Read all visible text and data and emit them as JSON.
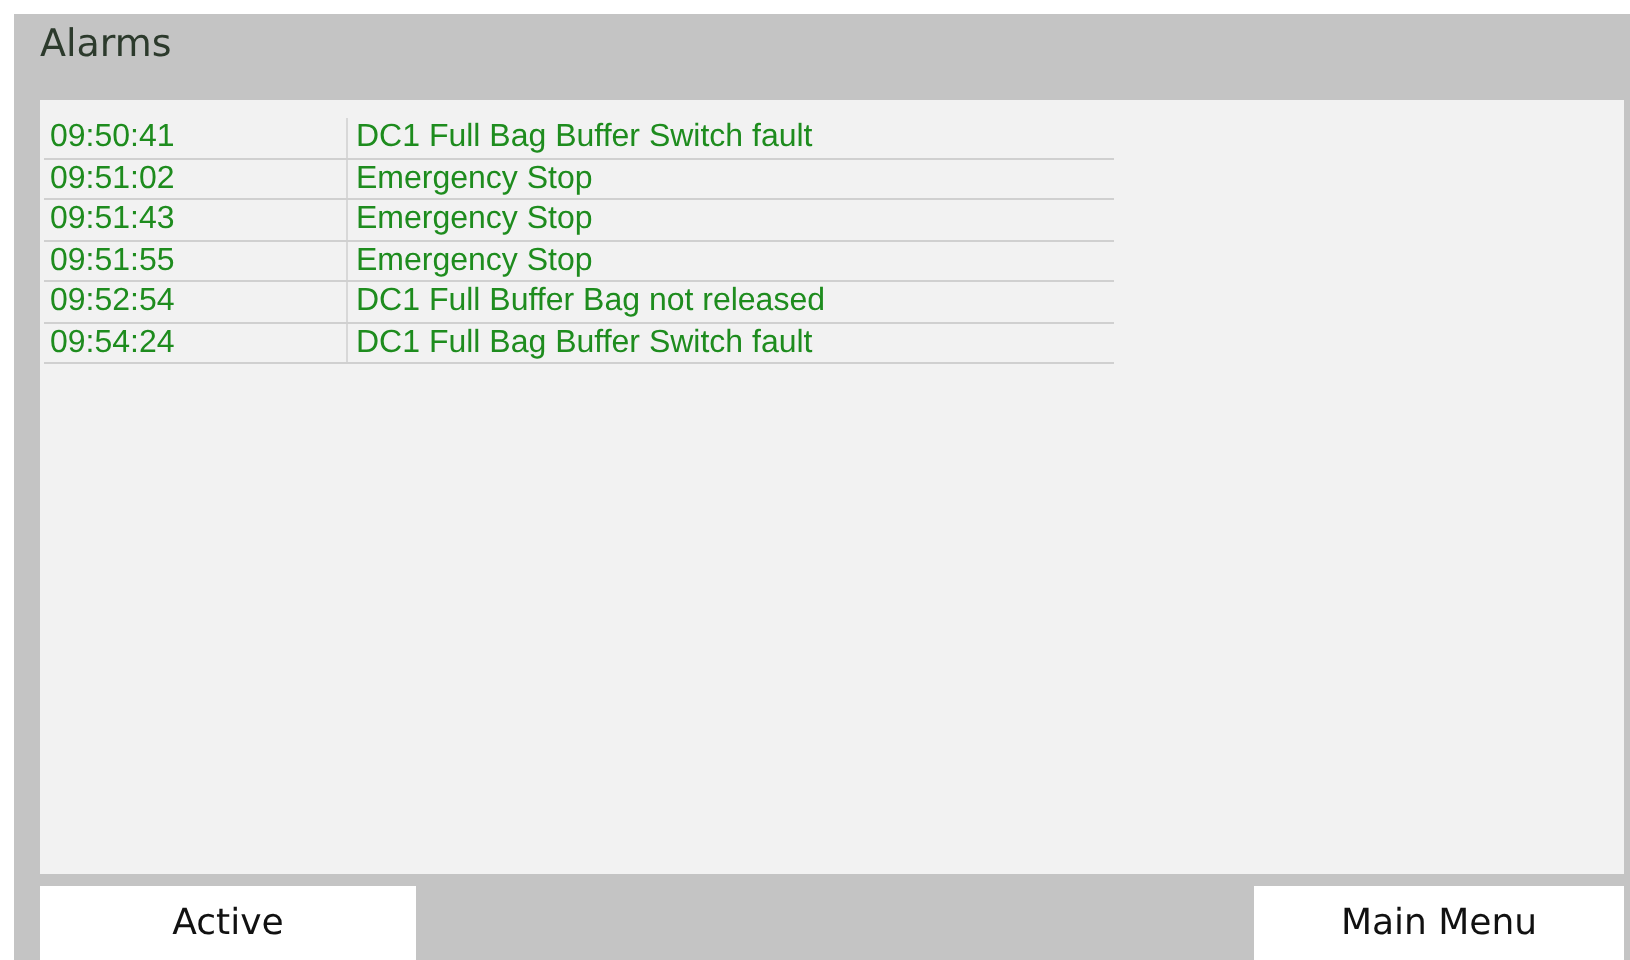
{
  "window": {
    "title": "Alarms"
  },
  "alarms": [
    {
      "time": "09:50:41",
      "message": "DC1 Full Bag Buffer Switch fault"
    },
    {
      "time": "09:51:02",
      "message": "Emergency Stop"
    },
    {
      "time": "09:51:43",
      "message": "Emergency Stop"
    },
    {
      "time": "09:51:55",
      "message": "Emergency Stop"
    },
    {
      "time": "09:52:54",
      "message": "DC1 Full Buffer Bag not released"
    },
    {
      "time": "09:54:24",
      "message": "DC1 Full Bag Buffer Switch fault"
    }
  ],
  "buttons": {
    "left": "Active",
    "right": "Main Menu"
  }
}
